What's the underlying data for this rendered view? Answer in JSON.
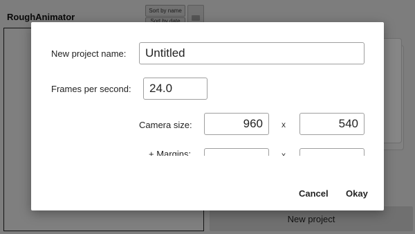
{
  "app": {
    "title": "RoughAnimator",
    "sort_label": "Sort by name",
    "sort_label_2": "Sort by date",
    "new_project_button": "New project"
  },
  "dialog": {
    "name_label": "New project name:",
    "name_value": "Untitled",
    "fps_label": "Frames per second:",
    "fps_value": "24.0",
    "camera_label": "Camera size:",
    "camera_width": "960",
    "camera_height": "540",
    "x_separator": "x",
    "margins_label": "+ Margins:",
    "margins_width": "",
    "margins_height": "",
    "cancel_label": "Cancel",
    "okay_label": "Okay"
  },
  "colors": {
    "scrim": "#000000",
    "dialog_bg": "#ffffff",
    "field_border": "#9e9e9e",
    "app_bg": "#e4e4e4"
  }
}
